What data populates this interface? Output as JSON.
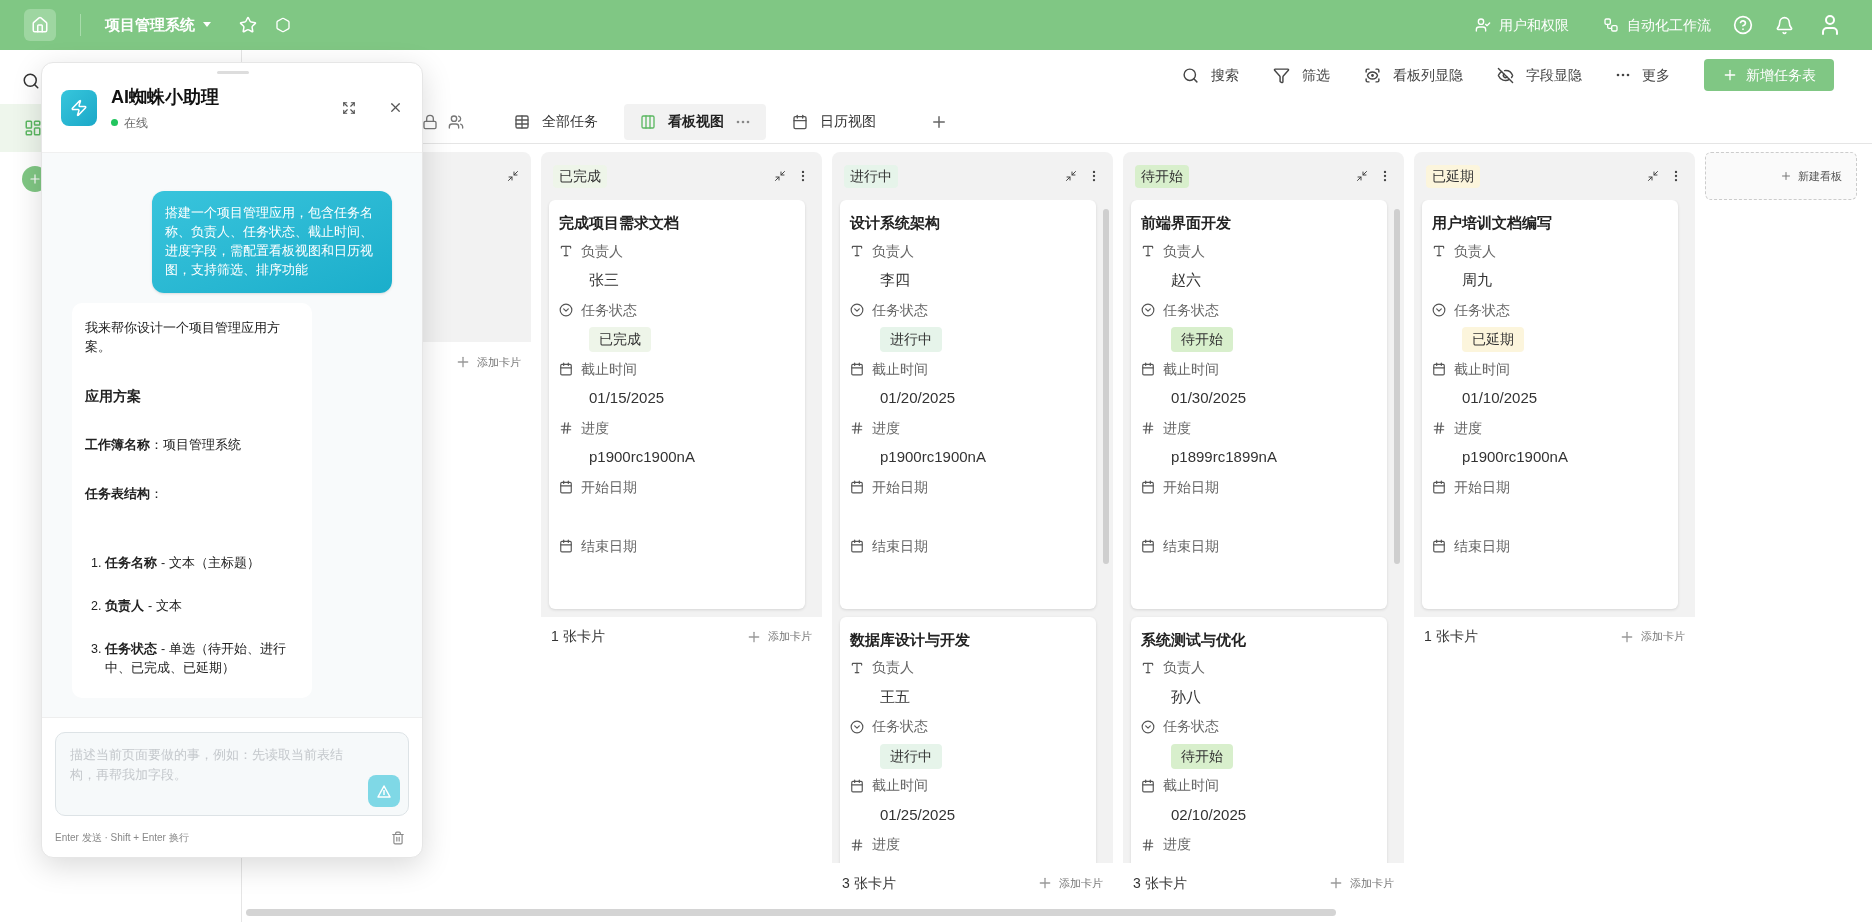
{
  "topbar": {
    "app_title": "项目管理系统",
    "actions": [
      {
        "kind": "permissions",
        "label": "用户和权限"
      },
      {
        "kind": "workflow",
        "label": "自动化工作流"
      }
    ]
  },
  "toolbar": {
    "items": [
      {
        "kind": "search",
        "label": "搜索"
      },
      {
        "kind": "filter",
        "label": "筛选"
      },
      {
        "kind": "columns",
        "label": "看板列显隐"
      },
      {
        "kind": "fields",
        "label": "字段显隐"
      },
      {
        "kind": "more",
        "label": "更多"
      }
    ],
    "primary_button": "新增任务表"
  },
  "view_tabs": [
    {
      "kind": "table",
      "label": "全部任务",
      "selected": false
    },
    {
      "kind": "board",
      "label": "看板视图",
      "selected": true
    },
    {
      "kind": "calendar",
      "label": "日历视图",
      "selected": false
    }
  ],
  "board": {
    "columns": [
      {
        "kind": "empty",
        "add_label": "添加卡片"
      },
      {
        "kind": "list",
        "title": "已完成",
        "color": "#eef5e9",
        "count": "1 张卡片",
        "add_label": "添加卡片",
        "cards": [
          {
            "title": "完成项目需求文档",
            "fields": [
              {
                "kind": "text",
                "label": "负责人",
                "value": "张三"
              },
              {
                "kind": "select",
                "label": "任务状态",
                "value": "已完成",
                "color": "#eef5e9"
              },
              {
                "kind": "date",
                "label": "截止时间",
                "value": "01/15/2025"
              },
              {
                "kind": "number",
                "label": "进度",
                "value": "p1900rc1900nA"
              },
              {
                "kind": "date",
                "label": "开始日期"
              },
              {
                "kind": "date",
                "label": "结束日期"
              }
            ]
          }
        ]
      },
      {
        "kind": "list",
        "title": "进行中",
        "color": "#e6f4ea",
        "count": "3 张卡片",
        "add_label": "添加卡片",
        "cards": [
          {
            "title": "设计系统架构",
            "fields": [
              {
                "kind": "text",
                "label": "负责人",
                "value": "李四"
              },
              {
                "kind": "select",
                "label": "任务状态",
                "value": "进行中",
                "color": "#e6f4ea"
              },
              {
                "kind": "date",
                "label": "截止时间",
                "value": "01/20/2025"
              },
              {
                "kind": "number",
                "label": "进度",
                "value": "p1900rc1900nA"
              },
              {
                "kind": "date",
                "label": "开始日期"
              },
              {
                "kind": "date",
                "label": "结束日期"
              }
            ]
          },
          {
            "title": "数据库设计与开发",
            "fields": [
              {
                "kind": "text",
                "label": "负责人",
                "value": "王五"
              },
              {
                "kind": "select",
                "label": "任务状态",
                "value": "进行中",
                "color": "#e6f4ea"
              },
              {
                "kind": "date",
                "label": "截止时间",
                "value": "01/25/2025"
              },
              {
                "kind": "number",
                "label": "进度"
              }
            ]
          }
        ]
      },
      {
        "kind": "list",
        "title": "待开始",
        "color": "#d8efcc",
        "count": "3 张卡片",
        "add_label": "添加卡片",
        "cards": [
          {
            "title": "前端界面开发",
            "fields": [
              {
                "kind": "text",
                "label": "负责人",
                "value": "赵六"
              },
              {
                "kind": "select",
                "label": "任务状态",
                "value": "待开始",
                "color": "#d8efcc"
              },
              {
                "kind": "date",
                "label": "截止时间",
                "value": "01/30/2025"
              },
              {
                "kind": "number",
                "label": "进度",
                "value": "p1899rc1899nA"
              },
              {
                "kind": "date",
                "label": "开始日期"
              },
              {
                "kind": "date",
                "label": "结束日期"
              }
            ]
          },
          {
            "title": "系统测试与优化",
            "fields": [
              {
                "kind": "text",
                "label": "负责人",
                "value": "孙八"
              },
              {
                "kind": "select",
                "label": "任务状态",
                "value": "待开始",
                "color": "#d8efcc"
              },
              {
                "kind": "date",
                "label": "截止时间",
                "value": "02/10/2025"
              },
              {
                "kind": "number",
                "label": "进度"
              }
            ]
          }
        ]
      },
      {
        "kind": "list",
        "title": "已延期",
        "color": "#fcf5dc",
        "count": "1 张卡片",
        "add_label": "添加卡片",
        "cards": [
          {
            "title": "用户培训文档编写",
            "fields": [
              {
                "kind": "text",
                "label": "负责人",
                "value": "周九"
              },
              {
                "kind": "select",
                "label": "任务状态",
                "value": "已延期",
                "color": "#fcf5dc"
              },
              {
                "kind": "date",
                "label": "截止时间",
                "value": "01/10/2025"
              },
              {
                "kind": "number",
                "label": "进度",
                "value": "p1900rc1900nA"
              },
              {
                "kind": "date",
                "label": "开始日期"
              },
              {
                "kind": "date",
                "label": "结束日期"
              }
            ]
          }
        ]
      }
    ],
    "new_column": "新建看板"
  },
  "assistant": {
    "title": "AI蜘蛛小助理",
    "status": "在线",
    "messages": [
      {
        "kind": "user",
        "text": "搭建一个项目管理应用，包含任务名称、负责人、任务状态、截止时间、进度字段，需配置看板视图和日历视图，支持筛选、排序功能"
      },
      {
        "kind": "bot",
        "blocks": [
          {
            "kind": "p",
            "text": "我来帮你设计一个项目管理应用方案。"
          },
          {
            "kind": "h",
            "text": "应用方案"
          },
          {
            "kind": "p",
            "text": "**工作簿名称**：项目管理系统"
          },
          {
            "kind": "p",
            "text": "**任务表结构**："
          },
          {
            "kind": "li",
            "number": "1.",
            "text": "**任务名称** - 文本（主标题）"
          },
          {
            "kind": "li",
            "number": "2.",
            "text": "**负责人** - 文本"
          },
          {
            "kind": "li",
            "number": "3.",
            "text": "**任务状态** - 单选（待开始、进行中、已完成、已延期）"
          }
        ]
      }
    ],
    "input_placeholder": "描述当前页面要做的事，例如：先读取当前表结构，再帮我加字段。",
    "hint": "Enter 发送 · Shift + Enter 换行"
  }
}
